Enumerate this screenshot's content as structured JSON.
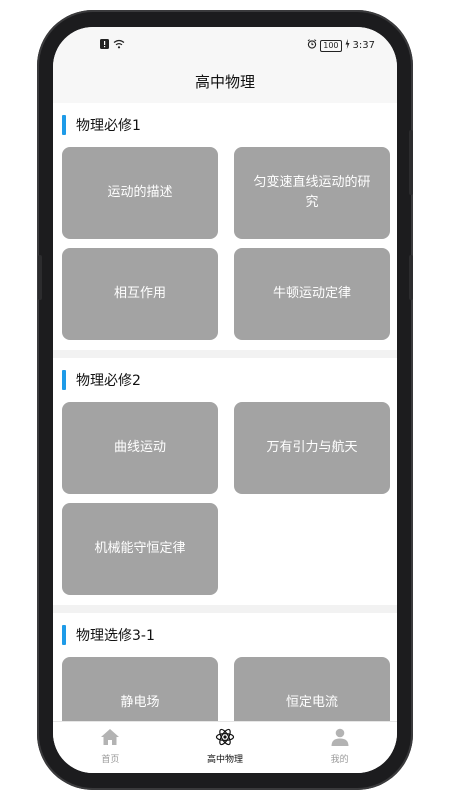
{
  "status_bar": {
    "time": "3:37",
    "battery": "100"
  },
  "header": {
    "title": "高中物理"
  },
  "sections": [
    {
      "title": "物理必修1",
      "items": [
        "运动的描述",
        "匀变速直线运动的研究",
        "相互作用",
        "牛顿运动定律"
      ]
    },
    {
      "title": "物理必修2",
      "items": [
        "曲线运动",
        "万有引力与航天",
        "机械能守恒定律"
      ]
    },
    {
      "title": "物理选修3-1",
      "items": [
        "静电场",
        "恒定电流"
      ]
    }
  ],
  "bottom_nav": [
    {
      "label": "首页",
      "icon": "home-icon"
    },
    {
      "label": "高中物理",
      "icon": "atom-icon"
    },
    {
      "label": "我的",
      "icon": "person-icon"
    }
  ],
  "colors": {
    "accent": "#1e9be8",
    "card": "#a3a3a3"
  }
}
